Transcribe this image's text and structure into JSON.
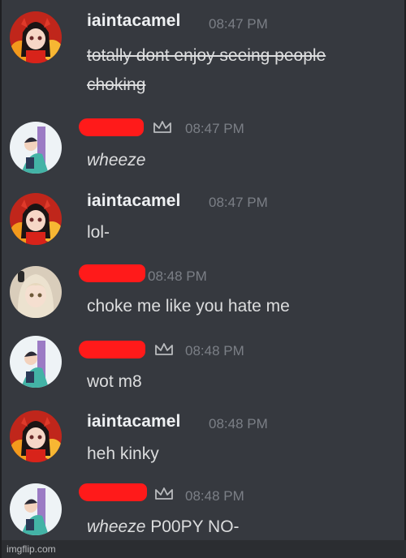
{
  "colors": {
    "background": "#36393f",
    "username": "#eef0f2",
    "text": "#dcddde",
    "timestamp": "#7b7f86",
    "redaction": "#ff1a1a"
  },
  "messages": [
    {
      "username": "iaintacamel",
      "time": "08:47 PM",
      "lines": [
        "totally dont enjoy seeing people",
        "choking"
      ],
      "avatar": "red-devil-anime-avatar"
    },
    {
      "username": "",
      "time": "08:47 PM",
      "text": "wheeze",
      "avatar": "anime-couple-avatar"
    },
    {
      "username": "iaintacamel",
      "time": "08:47 PM",
      "text": "lol-",
      "avatar": "red-devil-anime-avatar"
    },
    {
      "username": "",
      "time": "08:48 PM",
      "text": "choke me like you hate me",
      "avatar": "blonde-anime-girl-avatar"
    },
    {
      "username": "",
      "time": "08:48 PM",
      "text": "wot m8",
      "avatar": "anime-couple-avatar"
    },
    {
      "username": "iaintacamel",
      "time": "08:48 PM",
      "text": "heh kinky",
      "avatar": "red-devil-anime-avatar"
    },
    {
      "username": "",
      "time": "08:48 PM",
      "text_italic": "wheeze",
      "text_rest": " P00PY NO-",
      "avatar": "anime-couple-avatar"
    }
  ],
  "watermark": "imgflip.com"
}
